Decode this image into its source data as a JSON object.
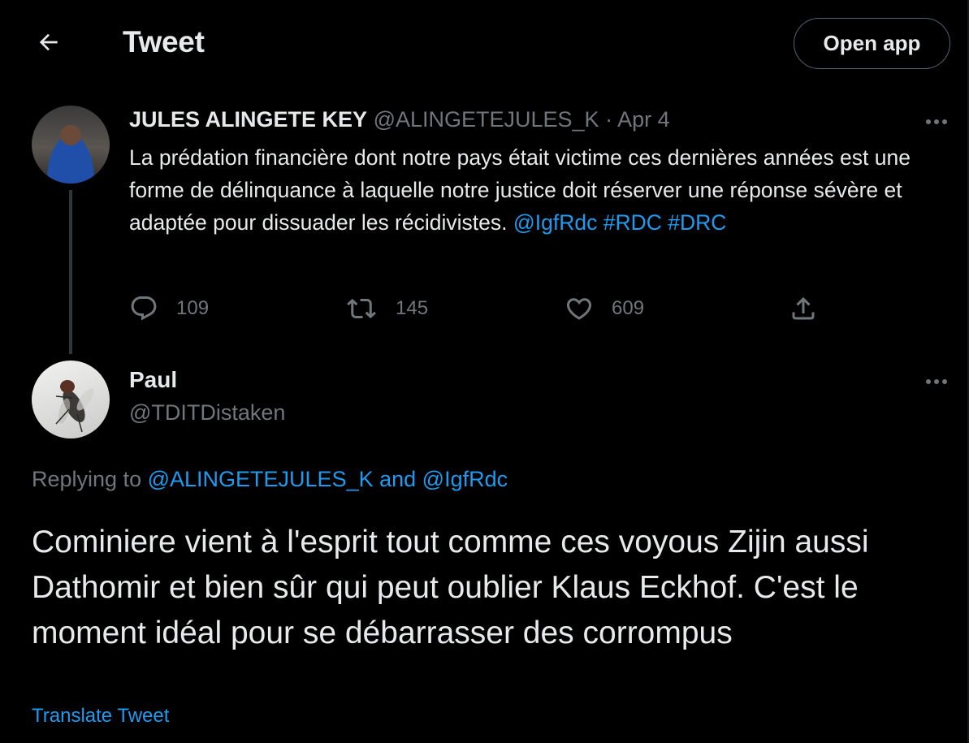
{
  "header": {
    "title": "Tweet",
    "open_app_label": "Open app",
    "back_icon": "arrow-left-icon"
  },
  "parent_tweet": {
    "author_name": "JULES ALINGETE KEY",
    "author_handle": "@ALINGETEJULES_K",
    "separator": "·",
    "date": "Apr 4",
    "text_parts": {
      "body": "La prédation financière dont notre pays était victime ces dernières années est une forme de délinquance à laquelle notre justice doit réserver une réponse sévère et adaptée pour dissuader les récidivistes. ",
      "mention": "@IgfRdc",
      "hashtag1": "#RDC",
      "hashtag2": "#DRC"
    },
    "stats": {
      "replies": "109",
      "retweets": "145",
      "likes": "609"
    },
    "icons": [
      "reply-icon",
      "retweet-icon",
      "like-icon",
      "share-icon",
      "more-icon"
    ]
  },
  "reply": {
    "author_name": "Paul",
    "author_handle": "@TDITDistaken",
    "replying_prefix": "Replying to ",
    "replying_to_1": "@ALINGETEJULES_K",
    "replying_and": " and ",
    "replying_to_2": "@IgfRdc",
    "text": "Cominiere vient à l'esprit tout comme ces voyous Zijin aussi Dathomir et bien sûr qui peut oublier Klaus Eckhof. C'est le moment idéal pour se débarrasser des corrompus",
    "translate_label": "Translate Tweet"
  },
  "colors": {
    "background": "#000000",
    "text": "#e7e9ea",
    "muted": "#71767b",
    "link": "#1d9bf0",
    "border": "#536471"
  }
}
